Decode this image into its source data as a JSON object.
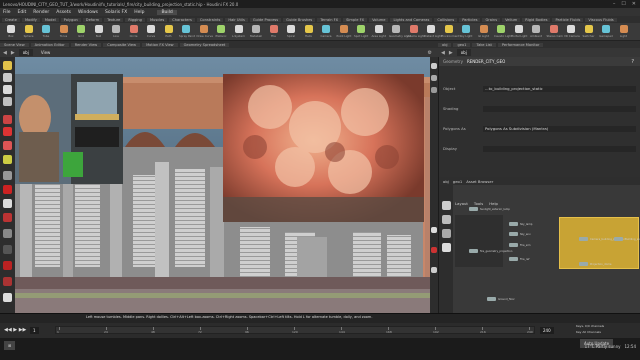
{
  "window": {
    "title": "Lenovo/HOUDINI_CITY_GEO_TUT_3/work/Houdini/fx_tutorials/_fire/city_building_projection_static.hip - Houdini FX 20.0"
  },
  "menubar": {
    "items": [
      "File",
      "Edit",
      "Render",
      "Assets",
      "Windows",
      "Solaris FX",
      "Help"
    ],
    "build": "Build"
  },
  "shelf_tabs": [
    "Create",
    "Modify",
    "Model",
    "Polygon",
    "Deform",
    "Texture",
    "Rigging",
    "Muscles",
    "Characters",
    "Constraints",
    "Hair Utils",
    "Guide Process",
    "Guide Brushes",
    "Terrain FX",
    "Simple FX",
    "Volume",
    "Lights and Cameras",
    "Collisions",
    "Particles",
    "Grains",
    "Vellum",
    "Rigid Bodies",
    "Particle Fluids",
    "Viscous Fluids"
  ],
  "shelf_tools": [
    "Box",
    "Sphere",
    "Tube",
    "Torus",
    "Grid",
    "Null",
    "Line",
    "Circle",
    "Curve",
    "Path",
    "Spray Paint",
    "Draw Curve",
    "Platonic",
    "L-System",
    "Metaball",
    "File",
    "Spiral",
    "Helix",
    "Camera",
    "Point Light",
    "Spot Light",
    "Area Light",
    "Geometry Light",
    "Volume Light",
    "Distant Light",
    "Environment",
    "Sky Light",
    "GI Light",
    "Caustic Light",
    "Portal Light",
    "Ambient",
    "Stereo Cam",
    "VR Camera",
    "Switcher",
    "Gamepad",
    "Light"
  ],
  "pane_tabs": [
    "Scene View",
    "Animation Editor",
    "Render View",
    "Composite View",
    "Motion FX View",
    "Geometry Spreadsheet"
  ],
  "right_pane_tabs": [
    "obj",
    "geo1",
    "Take List",
    "Performance Monitor"
  ],
  "viewport_path": "obj",
  "viewport_label": "View",
  "params": {
    "node_type": "Geometry",
    "node_name": "RENDER_CITY_GEO",
    "rows": [
      {
        "label": "Object",
        "value": "...to_building_projection_static"
      },
      {
        "label": "Shading",
        "value": ""
      },
      {
        "label": "Polygons As",
        "value": "Polygons As Subdivision (Mantra)"
      },
      {
        "label": "Display",
        "value": ""
      }
    ]
  },
  "network": {
    "tabs": [
      "obj",
      "geo1",
      "Asset Browser"
    ],
    "path": "obj",
    "labels": [
      "Layout",
      "Tools",
      "Help"
    ],
    "nodes": [
      "Sunlight_exterior_lamp",
      "Sky_lamp",
      "Sky_env",
      "Fire_sim",
      "Fire_ref",
      "fire_geometry_projection",
      "Camera_building_projector",
      "Building_source",
      "Projection_dome",
      "Ground_floor"
    ]
  },
  "timeline": {
    "status": "Left mouse tumbles. Middle pans. Right dollies. Ctrl+Alt+Left box-zooms. Ctrl+Right zooms. Spacebar+Ctrl+Left tilts. Hold L for alternate tumble, dolly, and zoom.",
    "frame": "1",
    "start": "1",
    "end": "240",
    "ticks": [
      "1",
      "24",
      "48",
      "72",
      "96",
      "120",
      "144",
      "168",
      "192",
      "216",
      "240"
    ]
  },
  "taskbar": {
    "weather": "17°C Partly sunny",
    "time": "12:54",
    "buttons": [
      "Keys, 0/0 channels",
      "Key All Channels",
      "Auto Update"
    ]
  },
  "colors": {
    "accent": "#c8a334",
    "fire": "#d9725a",
    "building": "#c98b6a",
    "sky": "#4c6b84"
  }
}
